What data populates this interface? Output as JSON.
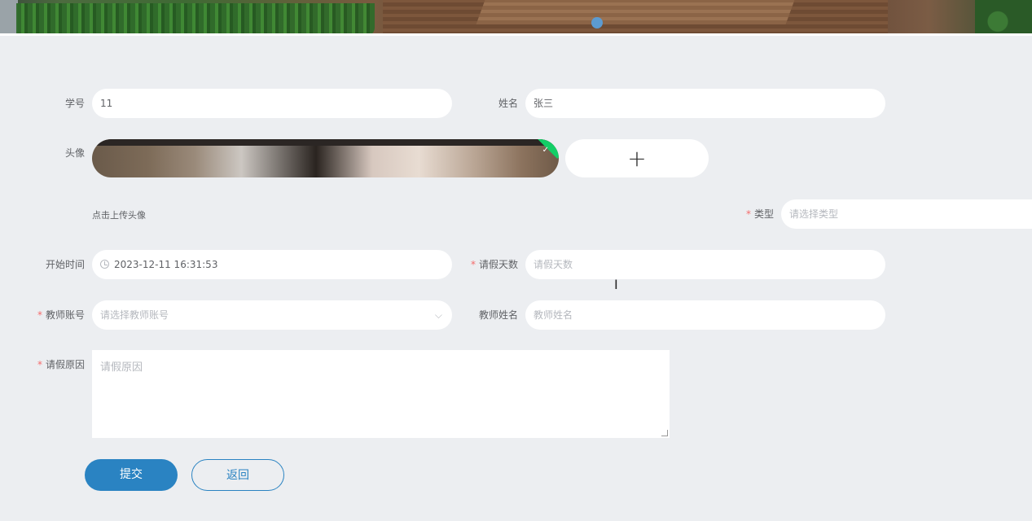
{
  "form": {
    "student_no": {
      "label": "学号",
      "value": "11"
    },
    "name": {
      "label": "姓名",
      "value": "张三"
    },
    "avatar": {
      "label": "头像",
      "hint": "点击上传头像",
      "add_glyph": "+"
    },
    "type": {
      "label": "类型",
      "required": "*",
      "placeholder": "请选择类型"
    },
    "start_time": {
      "label": "开始时间",
      "value": "2023-12-11 16:31:53"
    },
    "leave_days": {
      "label": "请假天数",
      "required": "*",
      "placeholder": "请假天数"
    },
    "teacher_account": {
      "label": "教师账号",
      "required": "*",
      "placeholder": "请选择教师账号"
    },
    "teacher_name": {
      "label": "教师姓名",
      "placeholder": "教师姓名"
    },
    "reason": {
      "label": "请假原因",
      "required": "*",
      "placeholder": "请假原因"
    }
  },
  "actions": {
    "submit": "提交",
    "back": "返回"
  },
  "icons": {
    "select_arrow": "chevron-down-icon",
    "clock": "clock-icon",
    "uploaded": "check-icon",
    "cursor": "text-cursor-icon"
  },
  "colors": {
    "primary": "#2a83c2",
    "required": "#f56c6c",
    "success": "#13ce66",
    "background": "#eceef1"
  }
}
